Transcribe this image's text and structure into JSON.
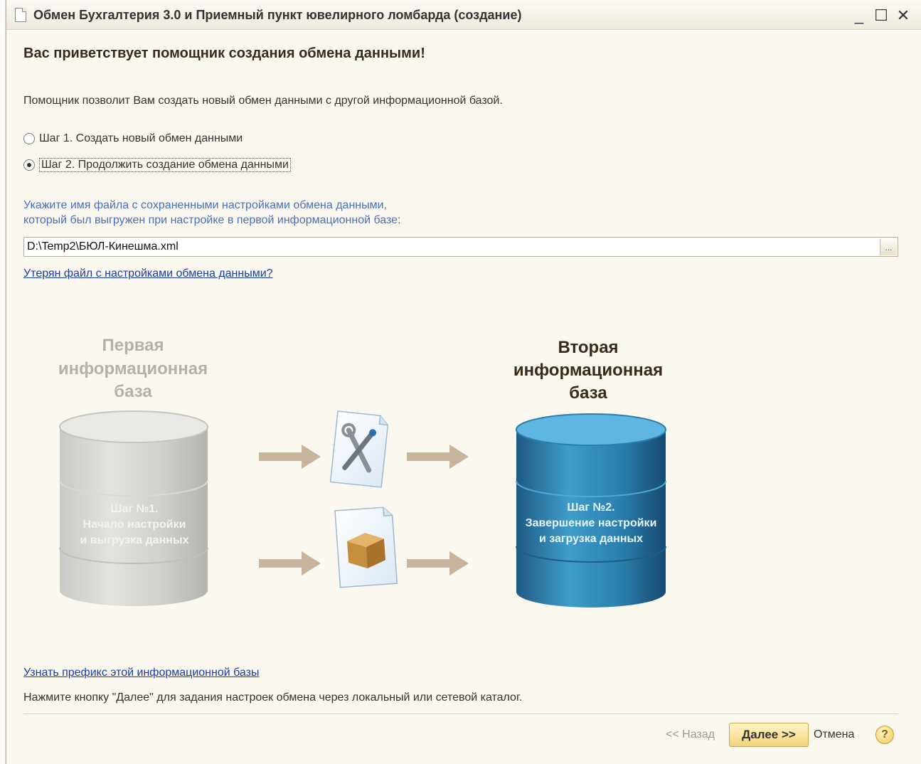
{
  "window": {
    "title": "Обмен Бухгалтерия 3.0 и Приемный пункт ювелирного ломбарда (создание)",
    "minimize": "_",
    "maximize": "☐",
    "close": "✕"
  },
  "main": {
    "heading": "Вас приветствует помощник создания обмена данными!",
    "intro": "Помощник позволит Вам создать новый обмен данными с другой информационной базой.",
    "options": [
      {
        "label": "Шаг 1. Создать новый обмен данными",
        "selected": false
      },
      {
        "label": "Шаг 2. Продолжить создание обмена данными",
        "selected": true
      }
    ],
    "hint_line1": "Укажите имя файла с сохраненными настройками обмена данными,",
    "hint_line2": "который был выгружен при настройке в первой информационной базе:",
    "file_path": "D:\\Temp2\\БЮЛ-Кинешма.xml",
    "browse_label": "...",
    "lost_file_link": "Утерян файл с настройками обмена данными?"
  },
  "illustration": {
    "first_db_title": [
      "Первая",
      "информационная",
      "база"
    ],
    "first_db_step": [
      "Шаг №1.",
      "Начало настройки",
      "и выгрузка данных"
    ],
    "second_db_title": [
      "Вторая",
      "информационная",
      "база"
    ],
    "second_db_step": [
      "Шаг №2.",
      "Завершение настройки",
      "и загрузка данных"
    ],
    "icons": [
      "settings-file-icon",
      "data-package-file-icon"
    ]
  },
  "footer": {
    "prefix_link": "Узнать префикс этой информационной базы",
    "instruction": "Нажмите кнопку \"Далее\" для задания настроек обмена через локальный или сетевой каталог.",
    "back_label": "<< Назад",
    "next_label": "Далее >>",
    "cancel_label": "Отмена",
    "help_label": "?"
  },
  "colors": {
    "background": "#fbf8ef",
    "link": "#1a3ca8",
    "hint": "#4a6dbf",
    "accent_button": "#f3d47a"
  }
}
